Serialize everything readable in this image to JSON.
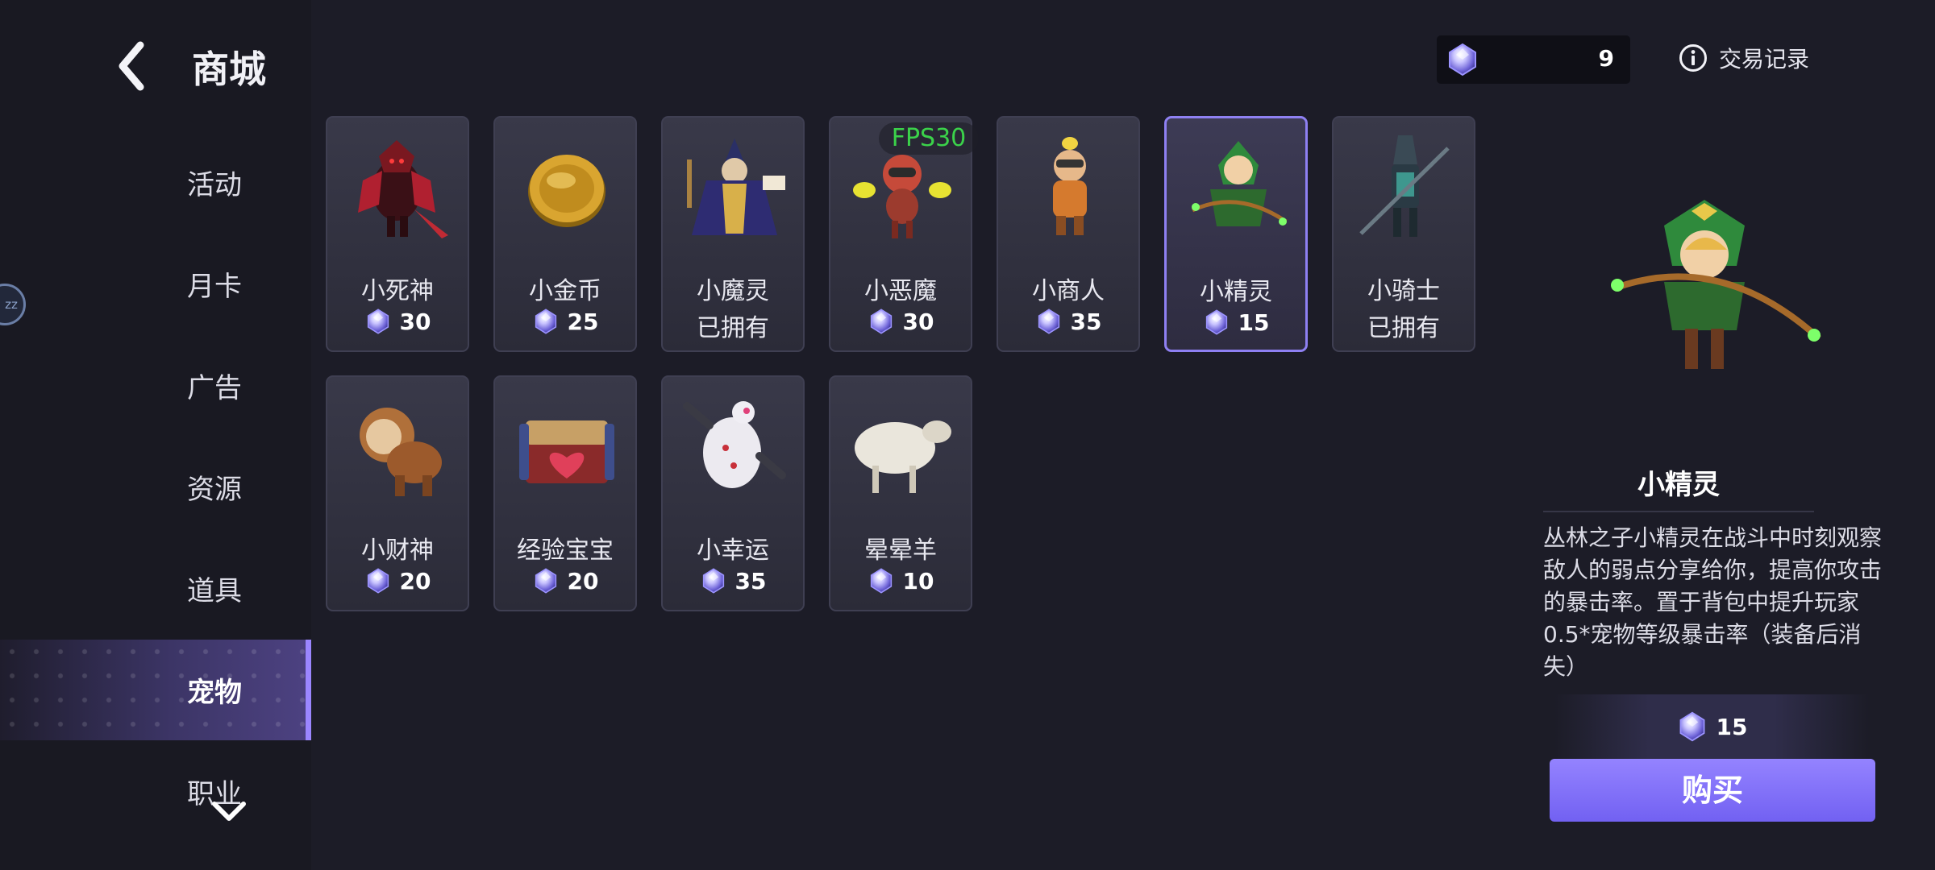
{
  "header": {
    "back_icon": "chevron-left-icon",
    "title": "商城"
  },
  "sidebar": {
    "items": [
      {
        "label": "活动"
      },
      {
        "label": "月卡"
      },
      {
        "label": "广告"
      },
      {
        "label": "资源"
      },
      {
        "label": "道具"
      },
      {
        "label": "宠物",
        "active": true
      },
      {
        "label": "职业"
      }
    ],
    "more_icon": "chevron-down-icon",
    "floating_badge": "zz"
  },
  "topbar": {
    "gem_count": "9",
    "history_label": "交易记录",
    "history_icon": "info-icon"
  },
  "fps": "FPS30",
  "pets": [
    {
      "name": "小死神",
      "price": "30",
      "owned": false
    },
    {
      "name": "小金币",
      "price": "25",
      "owned": false
    },
    {
      "name": "小魔灵",
      "status": "已拥有",
      "owned": true
    },
    {
      "name": "小恶魔",
      "price": "30",
      "owned": false
    },
    {
      "name": "小商人",
      "price": "35",
      "owned": false
    },
    {
      "name": "小精灵",
      "price": "15",
      "owned": false,
      "selected": true
    },
    {
      "name": "小骑士",
      "status": "已拥有",
      "owned": true
    },
    {
      "name": "小财神",
      "price": "20",
      "owned": false
    },
    {
      "name": "经验宝宝",
      "price": "20",
      "owned": false
    },
    {
      "name": "小幸运",
      "price": "35",
      "owned": false
    },
    {
      "name": "晕晕羊",
      "price": "10",
      "owned": false
    }
  ],
  "detail": {
    "name": "小精灵",
    "description": "丛林之子小精灵在战斗中时刻观察敌人的弱点分享给你，提高你攻击的暴击率。置于背包中提升玩家0.5*宠物等级暴击率（装备后消失）",
    "price": "15",
    "buy_label": "购买"
  },
  "colors": {
    "accent": "#8e80f2",
    "buy": "#7a68f7",
    "fps": "#3bd24a"
  }
}
